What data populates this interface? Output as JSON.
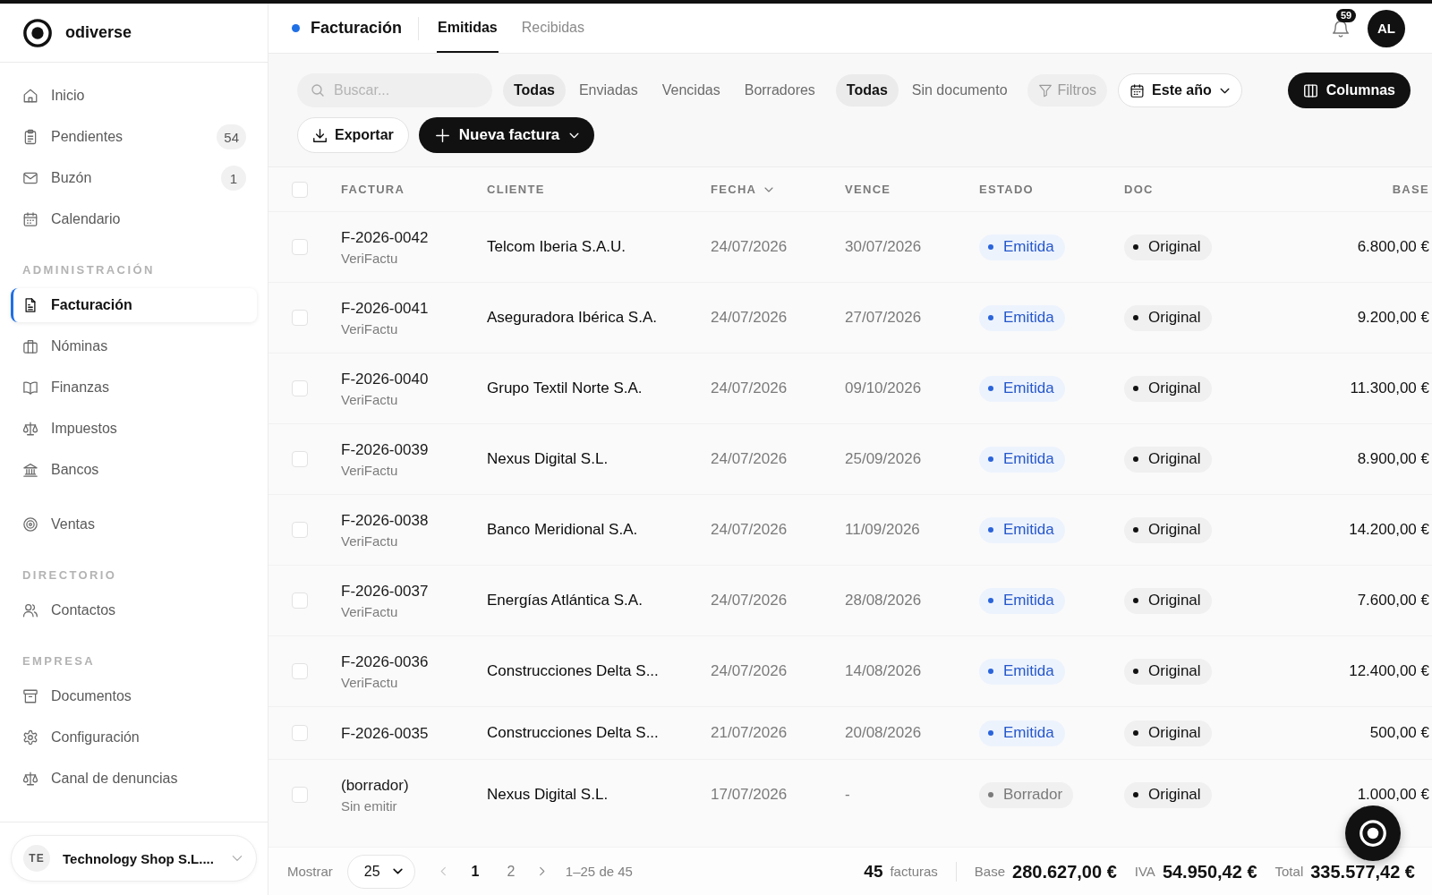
{
  "sidebar": {
    "brand": "odiverse",
    "sections": [
      {
        "items": [
          {
            "label": "Inicio",
            "selected": false
          },
          {
            "label": "Pendientes",
            "selected": false,
            "count": "54"
          },
          {
            "label": "Buzón",
            "selected": false,
            "count": "1"
          },
          {
            "label": "Calendario",
            "selected": false
          }
        ]
      },
      {
        "title": "ADMINISTRACIÓN",
        "items": [
          {
            "label": "Facturación",
            "selected": true
          },
          {
            "label": "Nóminas",
            "selected": false
          },
          {
            "label": "Finanzas",
            "selected": false
          },
          {
            "label": "Impuestos",
            "selected": false
          },
          {
            "label": "Bancos",
            "selected": false
          }
        ]
      },
      {
        "items": [
          {
            "label": "Ventas",
            "selected": false
          }
        ]
      },
      {
        "title": "DIRECTORIO",
        "items": [
          {
            "label": "Contactos",
            "selected": false
          }
        ]
      },
      {
        "title": "EMPRESA",
        "items": [
          {
            "label": "Documentos",
            "selected": false
          },
          {
            "label": "Configuración",
            "selected": false
          },
          {
            "label": "Canal de denuncias",
            "selected": false
          }
        ]
      }
    ],
    "company": {
      "initials": "TE",
      "name": "Technology Shop S.L...."
    }
  },
  "header": {
    "title": "Facturación",
    "tabs": [
      {
        "label": "Emitidas",
        "selected": true
      },
      {
        "label": "Recibidas",
        "selected": false
      }
    ],
    "notification_count": "59",
    "user_initials": "AL"
  },
  "toolbar": {
    "search": {
      "placeholder": "Buscar..."
    },
    "status_filters": [
      {
        "label": "Todas",
        "selected": true
      },
      {
        "label": "Enviadas",
        "selected": false
      },
      {
        "label": "Vencidas",
        "selected": false
      },
      {
        "label": "Borradores",
        "selected": false
      }
    ],
    "document_filters": [
      {
        "label": "Todas",
        "selected": true
      },
      {
        "label": "Sin documento",
        "selected": false
      }
    ],
    "filters_button": "Filtros",
    "period": "Este año",
    "columns_button": "Columnas",
    "export_button": "Exportar",
    "new_invoice_button": "Nueva factura"
  },
  "table": {
    "all_checked": false,
    "columns": [
      {
        "label": "FACTURA",
        "sorted": false
      },
      {
        "label": "CLIENTE",
        "sorted": false
      },
      {
        "label": "FECHA",
        "sorted": true
      },
      {
        "label": "VENCE",
        "sorted": false
      },
      {
        "label": "ESTADO",
        "sorted": false
      },
      {
        "label": "DOC",
        "sorted": false
      },
      {
        "label": "BASE",
        "sorted": false
      }
    ],
    "rows": [
      {
        "checked": false,
        "number": "F-2026-0042",
        "subtitle": "VeriFactu",
        "client": "Telcom Iberia S.A.U.",
        "date": "24/07/2026",
        "due_date": "30/07/2026",
        "status": {
          "label": "Emitida",
          "kind": "issued"
        },
        "document": "Original",
        "base": "6.800,00 €"
      },
      {
        "checked": false,
        "number": "F-2026-0041",
        "subtitle": "VeriFactu",
        "client": "Aseguradora Ibérica S.A.",
        "date": "24/07/2026",
        "due_date": "27/07/2026",
        "status": {
          "label": "Emitida",
          "kind": "issued"
        },
        "document": "Original",
        "base": "9.200,00 €"
      },
      {
        "checked": false,
        "number": "F-2026-0040",
        "subtitle": "VeriFactu",
        "client": "Grupo Textil Norte S.A.",
        "date": "24/07/2026",
        "due_date": "09/10/2026",
        "status": {
          "label": "Emitida",
          "kind": "issued"
        },
        "document": "Original",
        "base": "11.300,00 €"
      },
      {
        "checked": false,
        "number": "F-2026-0039",
        "subtitle": "VeriFactu",
        "client": "Nexus Digital S.L.",
        "date": "24/07/2026",
        "due_date": "25/09/2026",
        "status": {
          "label": "Emitida",
          "kind": "issued"
        },
        "document": "Original",
        "base": "8.900,00 €"
      },
      {
        "checked": false,
        "number": "F-2026-0038",
        "subtitle": "VeriFactu",
        "client": "Banco Meridional S.A.",
        "date": "24/07/2026",
        "due_date": "11/09/2026",
        "status": {
          "label": "Emitida",
          "kind": "issued"
        },
        "document": "Original",
        "base": "14.200,00 €"
      },
      {
        "checked": false,
        "number": "F-2026-0037",
        "subtitle": "VeriFactu",
        "client": "Energías Atlántica S.A.",
        "date": "24/07/2026",
        "due_date": "28/08/2026",
        "status": {
          "label": "Emitida",
          "kind": "issued"
        },
        "document": "Original",
        "base": "7.600,00 €"
      },
      {
        "checked": false,
        "number": "F-2026-0036",
        "subtitle": "VeriFactu",
        "client": "Construcciones Delta S...",
        "date": "24/07/2026",
        "due_date": "14/08/2026",
        "status": {
          "label": "Emitida",
          "kind": "issued"
        },
        "document": "Original",
        "base": "12.400,00 €"
      },
      {
        "checked": false,
        "number": "F-2026-0035",
        "client": "Construcciones Delta S...",
        "date": "21/07/2026",
        "due_date": "20/08/2026",
        "status": {
          "label": "Emitida",
          "kind": "issued"
        },
        "document": "Original",
        "base": "500,00 €"
      },
      {
        "checked": false,
        "number": "(borrador)",
        "subtitle": "Sin emitir",
        "client": "Nexus Digital S.L.",
        "date": "17/07/2026",
        "due_date": "-",
        "status": {
          "label": "Borrador",
          "kind": "draft"
        },
        "document": "Original",
        "base": "1.000,00 €"
      }
    ]
  },
  "footer": {
    "show_label": "Mostrar",
    "page_size": "25",
    "pages": [
      {
        "label": "1",
        "selected": true
      },
      {
        "label": "2",
        "selected": false
      }
    ],
    "range": "1–25 de 45",
    "invoice_count": "45",
    "count_label": "facturas",
    "totals": [
      {
        "label": "Base",
        "value": "280.627,00 €"
      },
      {
        "label": "IVA",
        "value": "54.950,42 €"
      },
      {
        "label": "Total",
        "value": "335.577,42 €"
      }
    ]
  }
}
